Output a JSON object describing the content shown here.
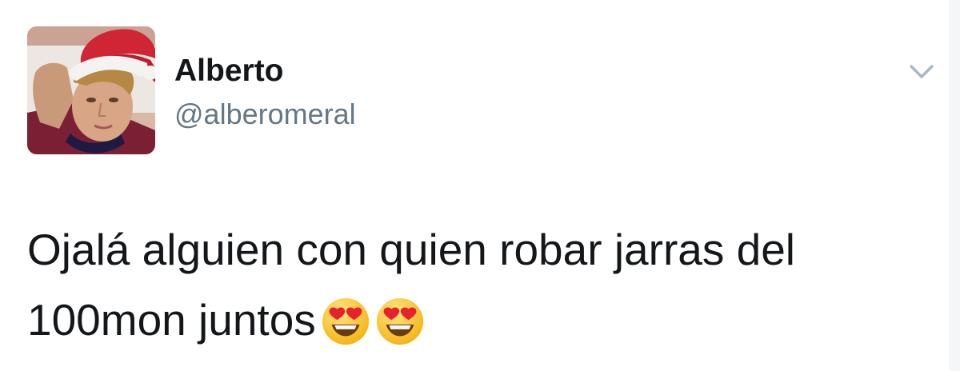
{
  "user": {
    "display_name": "Alberto",
    "handle": "@alberomeral"
  },
  "tweet": {
    "line1": "Ojalá alguien con quien robar jarras del",
    "line2": "100mon juntos"
  },
  "icons": {
    "avatar": "user-avatar-photo",
    "menu": "chevron-down-icon",
    "emoji": "heart-eyes-emoji-icon"
  },
  "colors": {
    "name": "#14171a",
    "handle": "#657786",
    "chevron": "#aab8c2"
  }
}
